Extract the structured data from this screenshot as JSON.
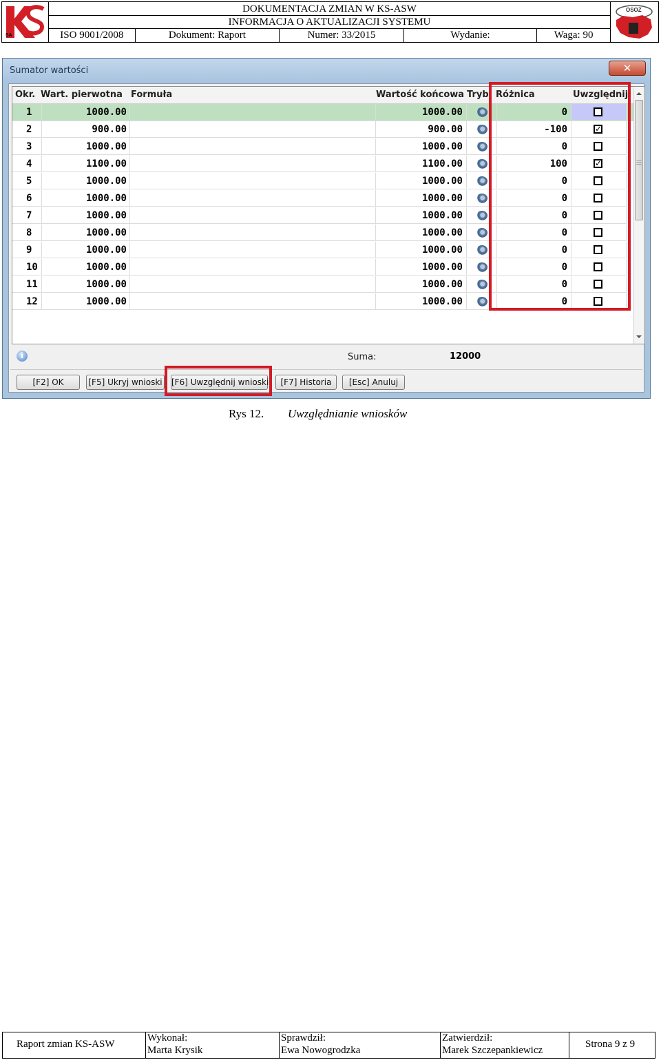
{
  "header": {
    "title_line1": "DOKUMENTACJA ZMIAN W KS-ASW",
    "title_line2": "INFORMACJA O AKTUALIZACJI SYSTEMU",
    "iso": "ISO 9001/2008",
    "document": "Dokument: Raport",
    "number": "Numer: 33/2015",
    "edition": "Wydanie:",
    "weight": "Waga: 90",
    "logo_left_text": "KS",
    "logo_left_sub": "SA",
    "logo_right_text": "OSOZ"
  },
  "dialog": {
    "title": "Sumator wartości",
    "close_label": "✕",
    "columns": {
      "okr": "Okr.",
      "wart": "Wart. pierwotna",
      "formula": "Formuła",
      "konc": "Wartość końcowa",
      "tryb": "Tryb",
      "rozn": "Różnica",
      "uwz": "Uwzględnij"
    },
    "rows": [
      {
        "okr": "1",
        "wart": "1000.00",
        "formula": "",
        "konc": "1000.00",
        "rozn": "0",
        "uwz": ""
      },
      {
        "okr": "2",
        "wart": "900.00",
        "formula": "",
        "konc": "900.00",
        "rozn": "-100",
        "uwz": "✓"
      },
      {
        "okr": "3",
        "wart": "1000.00",
        "formula": "",
        "konc": "1000.00",
        "rozn": "0",
        "uwz": ""
      },
      {
        "okr": "4",
        "wart": "1100.00",
        "formula": "",
        "konc": "1100.00",
        "rozn": "100",
        "uwz": "✓"
      },
      {
        "okr": "5",
        "wart": "1000.00",
        "formula": "",
        "konc": "1000.00",
        "rozn": "0",
        "uwz": ""
      },
      {
        "okr": "6",
        "wart": "1000.00",
        "formula": "",
        "konc": "1000.00",
        "rozn": "0",
        "uwz": ""
      },
      {
        "okr": "7",
        "wart": "1000.00",
        "formula": "",
        "konc": "1000.00",
        "rozn": "0",
        "uwz": ""
      },
      {
        "okr": "8",
        "wart": "1000.00",
        "formula": "",
        "konc": "1000.00",
        "rozn": "0",
        "uwz": ""
      },
      {
        "okr": "9",
        "wart": "1000.00",
        "formula": "",
        "konc": "1000.00",
        "rozn": "0",
        "uwz": ""
      },
      {
        "okr": "10",
        "wart": "1000.00",
        "formula": "",
        "konc": "1000.00",
        "rozn": "0",
        "uwz": ""
      },
      {
        "okr": "11",
        "wart": "1000.00",
        "formula": "",
        "konc": "1000.00",
        "rozn": "0",
        "uwz": ""
      },
      {
        "okr": "12",
        "wart": "1000.00",
        "formula": "",
        "konc": "1000.00",
        "rozn": "0",
        "uwz": ""
      }
    ],
    "selected_row": 1,
    "suma_label": "Suma:",
    "suma_value": "12000",
    "buttons": {
      "ok": "[F2] OK",
      "hide": "[F5] Ukryj wnioski",
      "include": "[F6] Uwzględnij wnioski",
      "history": "[F7] Historia",
      "cancel": "[Esc] Anuluj"
    },
    "highlight_color": "#d11b25",
    "selected_row_color": "#bfe0c0"
  },
  "caption": {
    "number": "Rys 12.",
    "text": "Uwzględnianie wniosków"
  },
  "footer": {
    "report": "Raport zmian KS-ASW",
    "made_by_label": "Wykonał:",
    "made_by": "Marta Krysik",
    "checked_label": "Sprawdził:",
    "checked_by": "Ewa Nowogrodzka",
    "approved_label": "Zatwierdził:",
    "approved_by": "Marek Szczepankiewicz",
    "page": "Strona 9 z 9"
  }
}
